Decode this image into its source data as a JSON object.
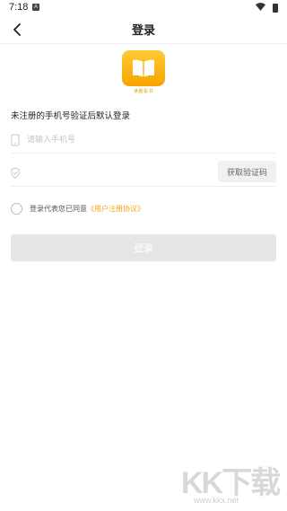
{
  "status_bar": {
    "time": "7:18",
    "notification_badge": "A",
    "wifi_icon": "wifi-icon",
    "battery_icon": "battery-icon"
  },
  "nav": {
    "back_icon": "chevron-left-icon",
    "title": "登录"
  },
  "logo": {
    "icon": "open-book-icon",
    "caption": "读趣看书",
    "brand_color": "#F6A400"
  },
  "form": {
    "hint": "未注册的手机号验证后默认登录",
    "phone_placeholder": "请输入手机号",
    "phone_icon": "phone-icon",
    "code_icon": "shield-check-icon",
    "code_placeholder": "",
    "get_code_label": "获取验证码",
    "agree_prefix": "登录代表您已同意",
    "agree_link": "《用户注册协议》",
    "link_color": "#F2A61C",
    "login_label": "登录"
  },
  "watermark": {
    "logo_text": "KK下载",
    "url": "www.kkx.net"
  }
}
